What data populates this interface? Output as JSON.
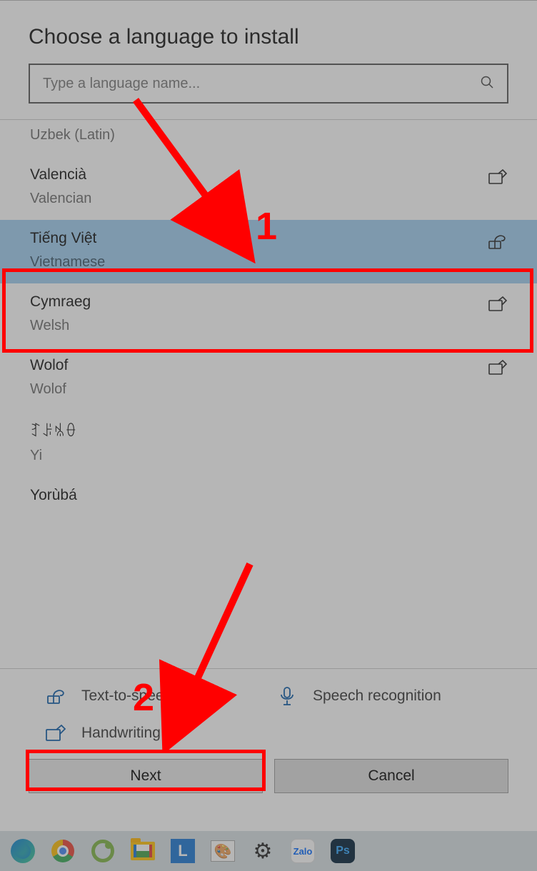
{
  "dialog": {
    "title": "Choose a language to install",
    "search": {
      "placeholder": "Type a language name...",
      "value": ""
    }
  },
  "languages": [
    {
      "native": "Uzbek (Latin)",
      "english": "",
      "handwriting": false,
      "tts": false,
      "partial_top": true
    },
    {
      "native": "Valencià",
      "english": "Valencian",
      "handwriting": true,
      "tts": false
    },
    {
      "native": "Tiếng Việt",
      "english": "Vietnamese",
      "handwriting": false,
      "tts": true,
      "selected": true
    },
    {
      "native": "Cymraeg",
      "english": "Welsh",
      "handwriting": true,
      "tts": false
    },
    {
      "native": "Wolof",
      "english": "Wolof",
      "handwriting": true,
      "tts": false
    },
    {
      "native": "ꆈꌠꁱꂷ",
      "english": "Yi",
      "handwriting": false,
      "tts": false
    },
    {
      "native": "Yorùbá",
      "english": "",
      "handwriting": false,
      "tts": false,
      "cutoff": true
    }
  ],
  "legend": {
    "tts": "Text-to-speech",
    "speech": "Speech recognition",
    "handwriting": "Handwriting"
  },
  "buttons": {
    "next": "Next",
    "cancel": "Cancel"
  },
  "taskbar": {
    "items": [
      "edge",
      "chrome",
      "coccoc",
      "explorer",
      "L",
      "paint",
      "settings",
      "zalo",
      "photoshop"
    ],
    "zalo_text": "Zalo",
    "ps_text": "Ps",
    "L_text": "L"
  },
  "annotations": {
    "num1": "1",
    "num2": "2"
  }
}
